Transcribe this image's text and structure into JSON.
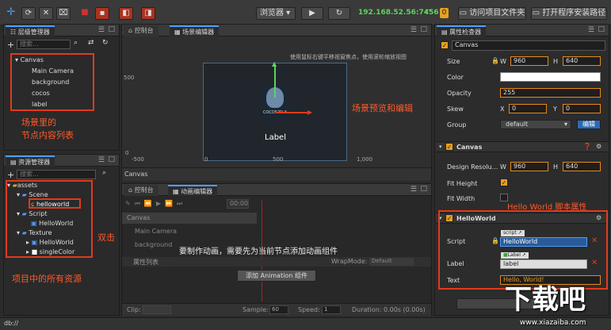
{
  "toolbar": {
    "preview_select": "浏览器",
    "ip": "192.168.52.56:7456",
    "badge": "0",
    "open_project_btn": "访问项目文件夹",
    "open_install_btn": "打开程序安装路径"
  },
  "hierarchy": {
    "title": "层级管理器",
    "search_placeholder": "搜索...",
    "nodes": [
      "Canvas",
      "Main Camera",
      "background",
      "cocos",
      "label"
    ],
    "annotation_1": "场景里的",
    "annotation_2": "节点内容列表"
  },
  "assets": {
    "title": "资源管理器",
    "search_placeholder": "搜索...",
    "root": "assets",
    "scene_folder": "Scene",
    "scene_file": "helloworld",
    "script_folder": "Script",
    "script_file": "HelloWorld",
    "texture_folder": "Texture",
    "tex1": "HelloWorld",
    "tex2": "singleColor",
    "annotation_double": "双击",
    "annotation_all": "项目中的所有资源"
  },
  "status": {
    "path": "db://"
  },
  "console_tab": "控制台",
  "scene": {
    "tab_console": "控制台",
    "tab_scene": "场景编辑器",
    "hint": "使用鼠标右键平移视窗焦点，使用滚轮缩放视图",
    "annotation": "场景预览和编辑",
    "axis_minus": "-500",
    "axis_zero": "0",
    "axis_500": "500",
    "axis_1000": "1,000",
    "axis_y_500": "500",
    "axis_y_0": "0",
    "label_text": "Label",
    "logo_text": "COCOS2D-X",
    "footer": "Canvas"
  },
  "anim": {
    "tab_console": "控制台",
    "tab_anim": "动画编辑器",
    "frame": "00:00",
    "nodes": [
      "Canvas",
      "Main Camera",
      "background"
    ],
    "props_label": "属性列表",
    "wrap_label": "WrapMode:",
    "wrap_value": "Default",
    "notice": "要制作动画，需要先为当前节点添加动画组件",
    "add_btn": "添加 Animation 组件",
    "clip_label": "Clip:",
    "sample_label": "Sample:",
    "sample_value": "60",
    "speed_label": "Speed:",
    "speed_value": "1",
    "duration": "Duration: 0.00s (0.00s)"
  },
  "inspector": {
    "tab": "属性检查器",
    "node_name": "Canvas",
    "size_label": "Size",
    "w_label": "W",
    "w_value": "960",
    "h_label": "H",
    "h_value": "640",
    "color_label": "Color",
    "opacity_label": "Opacity",
    "opacity_value": "255",
    "skew_label": "Skew",
    "skew_x": "0",
    "skew_y": "0",
    "x_label": "X",
    "y_label": "Y",
    "group_label": "Group",
    "group_value": "default",
    "edit_btn": "编辑",
    "canvas_section": "Canvas",
    "design_label": "Design Resolu...",
    "design_w": "960",
    "design_h": "640",
    "fit_height": "Fit Height",
    "fit_width": "Fit Width",
    "hw_section": "HelloWorld",
    "hw_annotation": "Hello World 脚本属性",
    "script_label": "Script",
    "script_tag": "script",
    "script_value": "HelloWorld",
    "label_label": "Label",
    "label_tag": "Label",
    "label_value": "label",
    "text_label": "Text",
    "text_value": "Hello, World!"
  },
  "watermark": {
    "big": "下载吧",
    "url": "www.xiazaiba.com"
  },
  "colors": {
    "accent": "#4f9cf6",
    "annotation": "#ff5a2a",
    "ip": "#5fd35f"
  }
}
